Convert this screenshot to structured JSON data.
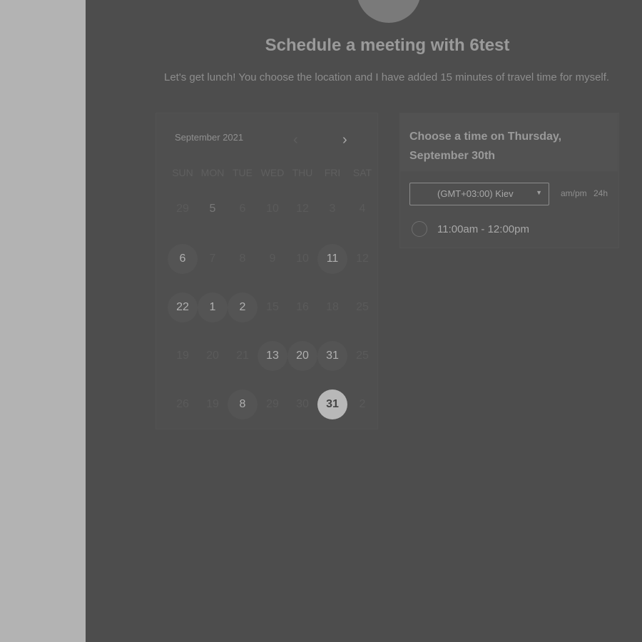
{
  "header": {
    "title": "Schedule a meeting with 6test",
    "description": "Let's get lunch! You choose the location and I have added 15 minutes of travel time for myself."
  },
  "calendar": {
    "month": "September 2021",
    "prev_icon": "chevron-left-icon",
    "next_icon": "chevron-right-icon",
    "weekdays": [
      "SUN",
      "MON",
      "TUE",
      "WED",
      "THU",
      "FRI",
      "SAT"
    ],
    "weeks": [
      [
        "29",
        "5",
        "6",
        "10",
        "12",
        "3",
        "4"
      ],
      [
        "6",
        "7",
        "8",
        "9",
        "10",
        "11",
        "12"
      ],
      [
        "22",
        "1",
        "2",
        "15",
        "16",
        "18",
        "25"
      ],
      [
        "19",
        "20",
        "21",
        "13",
        "20",
        "31",
        "25"
      ],
      [
        "26",
        "19",
        "8",
        "29",
        "30",
        "31",
        "2"
      ]
    ],
    "available": [
      [
        1,
        0
      ],
      [
        1,
        5
      ],
      [
        2,
        0
      ],
      [
        2,
        1
      ],
      [
        2,
        2
      ],
      [
        3,
        3
      ],
      [
        3,
        4
      ],
      [
        3,
        5
      ],
      [
        4,
        2
      ]
    ],
    "selected": [
      4,
      5
    ],
    "plain": [
      [
        0,
        1
      ]
    ]
  },
  "time_panel": {
    "title": "Choose a time on Thursday, September 30th",
    "timezone": "(GMT+03:00) Kiev",
    "format_ampm": "am/pm",
    "format_24h": "24h",
    "slots": [
      "11:00am - 12:00pm"
    ]
  },
  "colors": {
    "overlay": "#4d4d4d",
    "side_pane": "#b3b3b3",
    "selected_day": "#b8b8b8"
  }
}
